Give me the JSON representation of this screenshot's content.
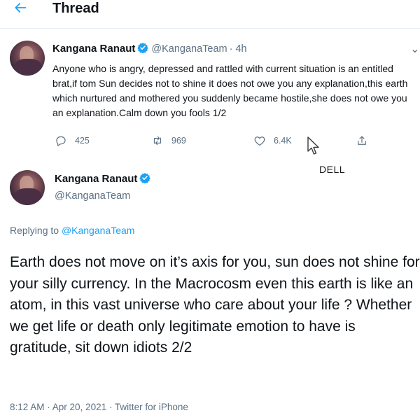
{
  "header": {
    "title": "Thread",
    "back_icon": "back-arrow-icon",
    "accent": "#1da1f2"
  },
  "tweet1": {
    "name": "Kangana Ranaut",
    "handle": "@KanganaTeam",
    "time": "· 4h",
    "text": "Anyone who is angry, depressed and rattled with current situation is an entitled brat,if tom Sun decides not to shine it does not owe you any explanation,this earth which nurtured and mothered you suddenly became hostile,she does not owe you an explanation.Calm down you fools 1/2",
    "actions": {
      "replies": "425",
      "retweets": "969",
      "likes": "6.4K"
    }
  },
  "overlay_label": "DELL",
  "tweet2": {
    "name": "Kangana Ranaut",
    "handle": "@KanganaTeam",
    "replying_prefix": "Replying to ",
    "replying_handle": "@KanganaTeam",
    "text": "Earth does not move on it’s axis for you, sun does not shine for your silly currency. In the Macrocosm even this earth is like an atom, in this vast universe who care about your life ? Whether we get life or death only legitimate emotion to have is gratitude, sit down idiots 2/2",
    "meta": "8:12 AM · Apr 20, 2021 · Twitter for iPhone"
  },
  "colors": {
    "verified": "#1da1f2",
    "secondary_text": "#5b7083",
    "divider": "#e6ecf0"
  }
}
